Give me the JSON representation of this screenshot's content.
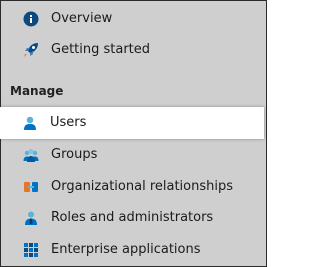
{
  "nav": {
    "top_items": [
      {
        "label": "Overview",
        "icon": "info-icon"
      },
      {
        "label": "Getting started",
        "icon": "rocket-icon"
      }
    ],
    "section_heading": "Manage",
    "manage_items": [
      {
        "label": "Users",
        "icon": "user-icon",
        "selected": true
      },
      {
        "label": "Groups",
        "icon": "groups-icon"
      },
      {
        "label": "Organizational relationships",
        "icon": "organizational-relationships-icon"
      },
      {
        "label": "Roles and administrators",
        "icon": "roles-icon"
      },
      {
        "label": "Enterprise applications",
        "icon": "enterprise-apps-icon"
      }
    ]
  },
  "colors": {
    "panel_background": "#cfcfcf",
    "selected_background": "#ffffff",
    "icon_blue": "#0072c6",
    "icon_light_blue": "#59b4d9",
    "icon_orange": "#e8742a"
  }
}
